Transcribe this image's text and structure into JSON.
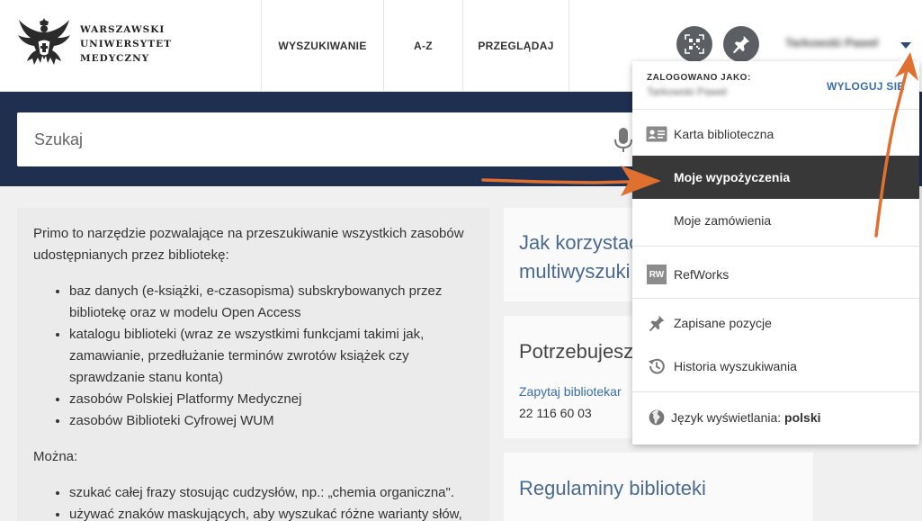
{
  "header": {
    "logo_lines": [
      "WARSZAWSKI",
      "UNIWERSYTET",
      "MEDYCZNY"
    ],
    "nav": [
      {
        "label": "WYSZUKIWANIE"
      },
      {
        "label": "A-Z"
      },
      {
        "label": "PRZEGLĄDAJ"
      }
    ],
    "user_name": "Tarkowski Paweł",
    "icons": {
      "qr": "qr-code-icon",
      "pin": "pushpin-icon",
      "caret": "caret-down-icon"
    }
  },
  "search": {
    "placeholder": "Szukaj",
    "value": "",
    "mic_icon": "microphone-icon"
  },
  "info": {
    "intro": "Primo to narzędzie pozwalające na przeszukiwanie wszystkich zasobów udostępnianych przez bibliotekę:",
    "bullets": [
      "baz danych (e-książki, e-czasopisma) subskrybowanych przez bibliotekę oraz w modelu Open Access",
      "katalogu biblioteki (wraz ze wszystkimi funkcjami takimi jak, zamawianie, przedłużanie terminów zwrotów książek czy sprawdzanie stanu konta)",
      "zasobów Polskiej Platformy Medycznej",
      "zasobów Biblioteki Cyfrowej WUM"
    ],
    "mozna": "Można:",
    "bullets2": [
      "szukać całej frazy stosując cudzysłów, np.: „chemia organiczna\".",
      "używać znaków maskujących, aby wyszukać różne warianty słów,"
    ]
  },
  "cards": {
    "howto_line1": "Jak korzystać",
    "howto_line2": "multiwyszuki",
    "need_title": "Potrzebujesz",
    "ask_link": "Zapytaj bibliotekar",
    "phone": "22 116 60 03",
    "rules_title": "Regulaminy biblioteki"
  },
  "menu": {
    "logged_label": "ZALOGOWANO JAKO:",
    "logged_user": "Tarkowski Paweł",
    "logout": "WYLOGUJ SIĘ",
    "items": [
      {
        "label": "Karta biblioteczna",
        "icon": "id-card-icon"
      },
      {
        "label": "Moje wypożyczenia",
        "icon": ""
      },
      {
        "label": "Moje zamówienia",
        "icon": ""
      },
      {
        "label": "RefWorks",
        "icon": "refworks-icon",
        "badge": "RW"
      },
      {
        "label": "Zapisane pozycje",
        "icon": "pushpin-icon"
      },
      {
        "label": "Historia wyszukiwania",
        "icon": "history-icon"
      }
    ],
    "language_label": "Język wyświetlania:",
    "language_value": "polski",
    "language_icon": "globe-icon"
  },
  "colors": {
    "navy": "#1e2f4f",
    "link": "#3a6ea5",
    "active_item": "#383838",
    "annotation_arrow": "#e07030"
  }
}
